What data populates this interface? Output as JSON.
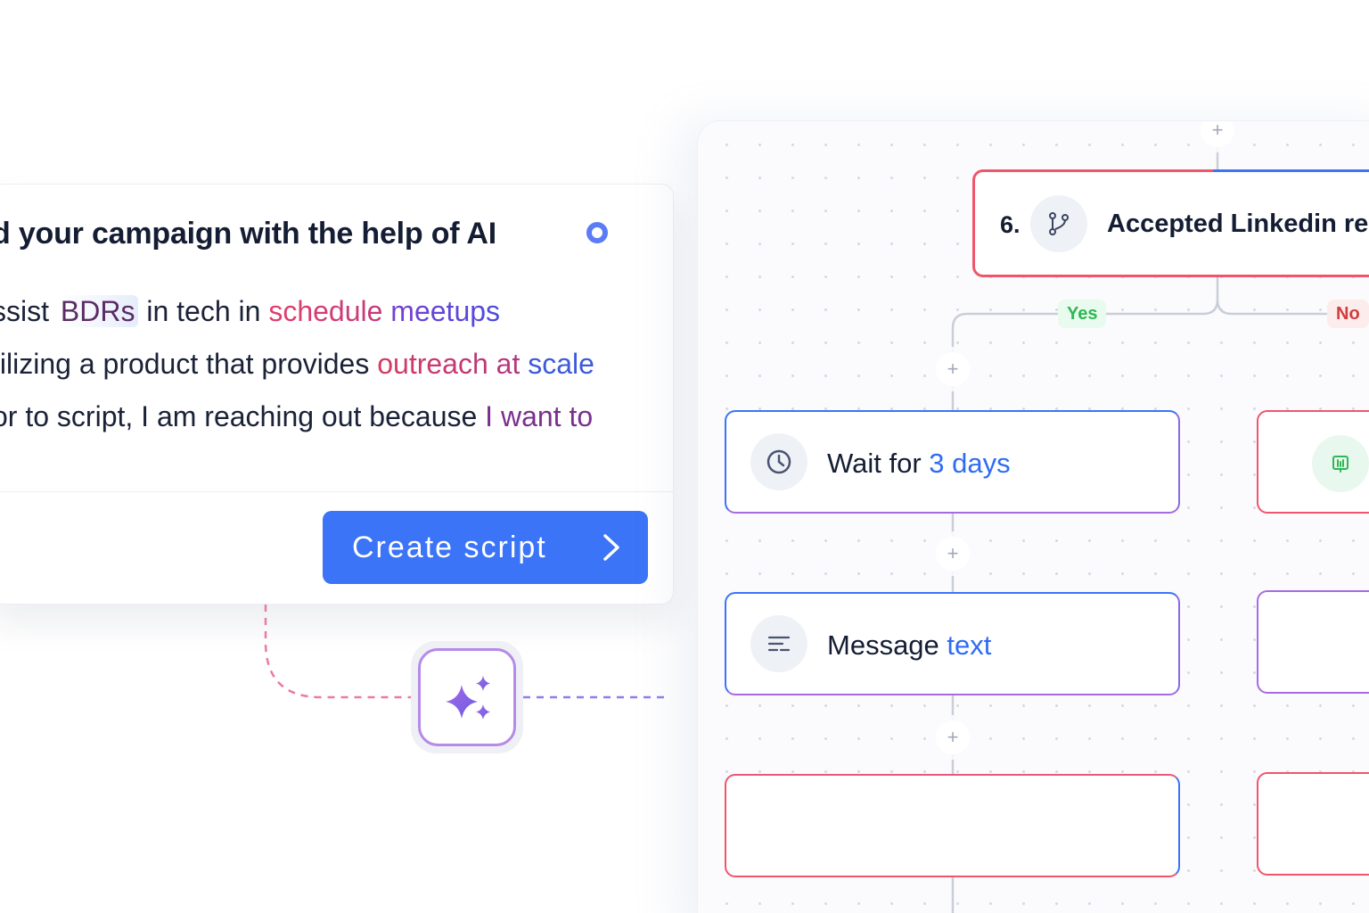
{
  "ai_card": {
    "title": "d your campaign with the help of AI",
    "prompt": {
      "line1": {
        "t1": "ssist ",
        "bdrs": "BDRs",
        "t2": " in tech in ",
        "h1": "schedule",
        "h2": " meetups"
      },
      "line2": {
        "t1": "tilizing a product that provides ",
        "h1": "outreach at",
        "h2": " scale"
      },
      "line3": {
        "t1": "or to script, I am reaching out because ",
        "h1": "I want to"
      }
    },
    "create_button_label": "Create  script"
  },
  "flow": {
    "trigger_node": {
      "step_number": "6.",
      "label": "Accepted Linkedin re",
      "icon": "branch-icon"
    },
    "branches": {
      "yes_label": "Yes",
      "no_label": "No"
    },
    "wait_node": {
      "label_prefix": "Wait for ",
      "label_value": "3 days",
      "icon": "clock-icon"
    },
    "message_node": {
      "label_prefix": "Message ",
      "label_value": "text",
      "icon": "text-lines-icon"
    },
    "no_branch_node_icon": "linkedin-icon",
    "plus_symbol": "+"
  },
  "colors": {
    "primary_blue": "#3b74f7",
    "accent_blue": "#2f6cf3",
    "node_red": "#f0556b",
    "node_purple": "#a66be0",
    "yes_green": "#2eb855",
    "no_red": "#d23c3c"
  }
}
